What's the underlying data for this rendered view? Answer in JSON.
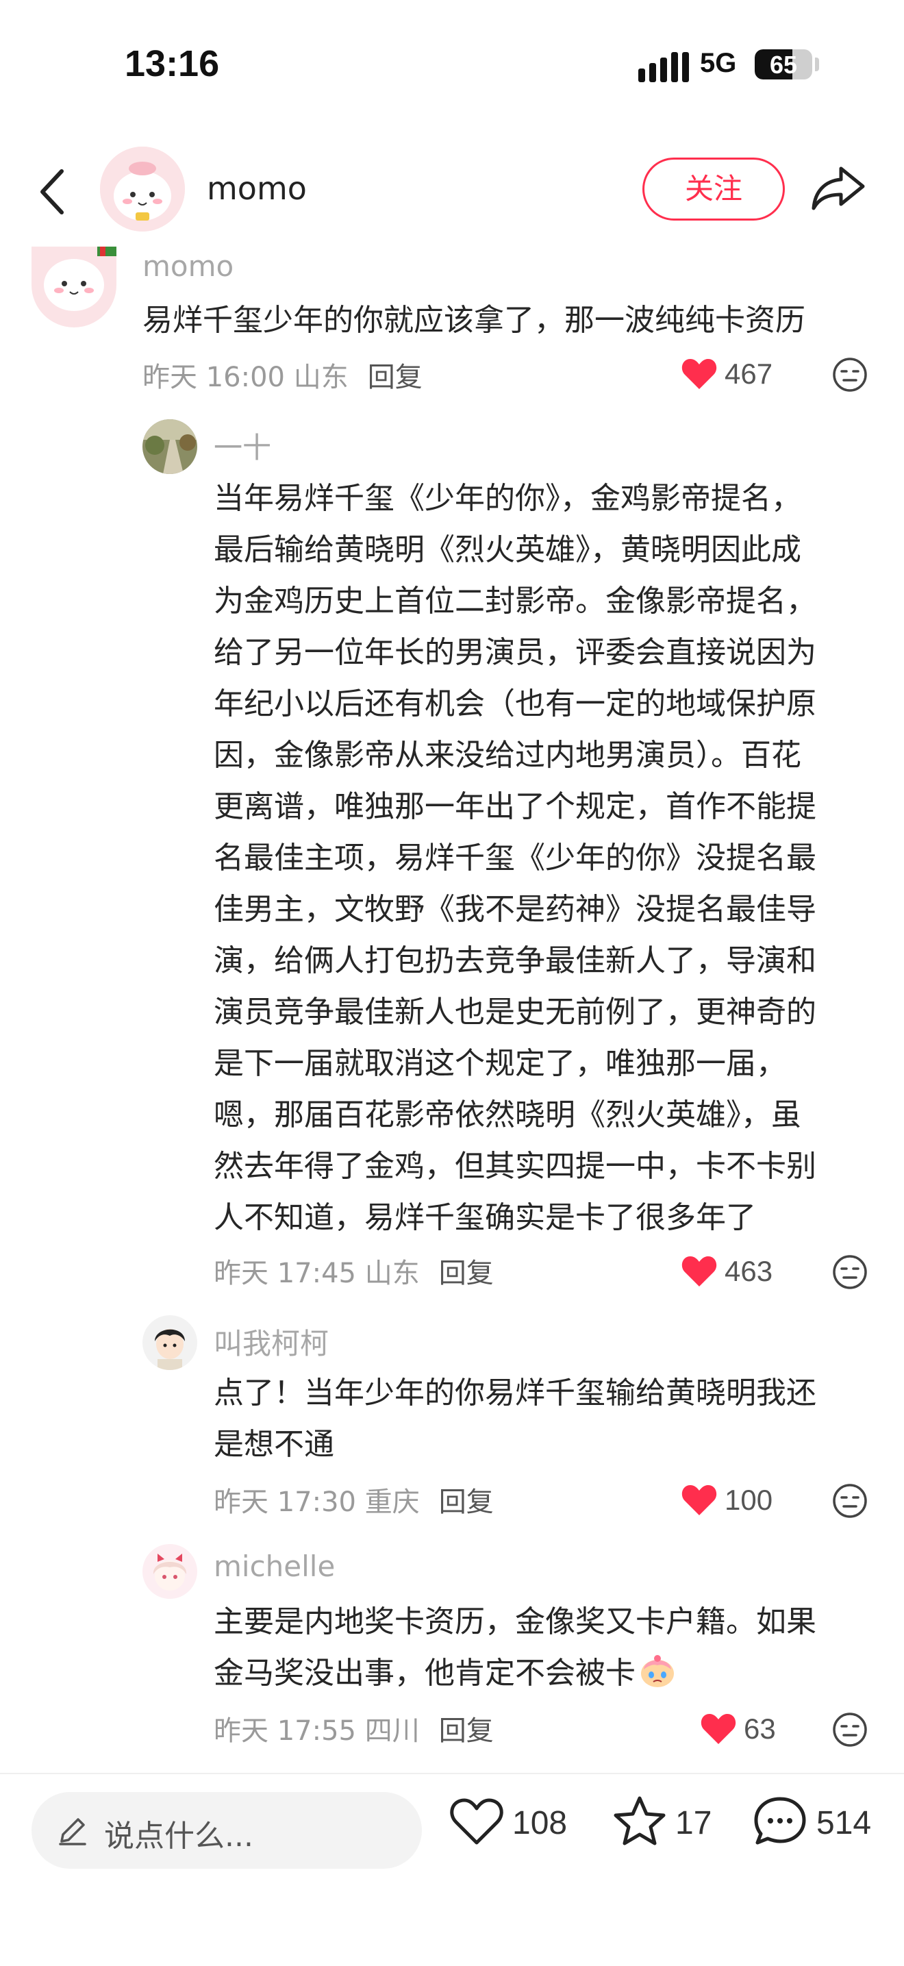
{
  "status_bar": {
    "time": "13:16",
    "network": "5G",
    "battery": "65",
    "battery_level": 0.65
  },
  "header": {
    "username": "momo",
    "follow_label": "关注"
  },
  "comments": [
    {
      "username": "momo",
      "text": "易烊千玺少年的你就应该拿了，那一波纯纯卡资历",
      "date": "昨天 16:00 山东",
      "reply_label": "回复",
      "likes": "467"
    },
    {
      "username": "一十",
      "lines": [
        "当年易烊千玺《少年的你》，金鸡影帝提名，",
        "最后输给黄晓明《烈火英雄》，黄晓明因此成",
        "为金鸡历史上首位二封影帝。金像影帝提名，",
        "给了另一位年长的男演员，评委会直接说因为",
        "年纪小以后还有机会（也有一定的地域保护原",
        "因，金像影帝从来没给过内地男演员）。百花",
        "更离谱，唯独那一年出了个规定，首作不能提",
        "名最佳主项，易烊千玺《少年的你》没提名最",
        "佳男主，文牧野《我不是药神》没提名最佳导",
        "演，给俩人打包扔去竞争最佳新人了，导演和",
        "演员竞争最佳新人也是史无前例了，更神奇的",
        "是下一届就取消这个规定了，唯独那一届，",
        "嗯，那届百花影帝依然晓明《烈火英雄》，虽",
        "然去年得了金鸡，但其实四提一中，卡不卡别",
        "人不知道，易烊千玺确实是卡了很多年了"
      ],
      "date": "昨天 17:45 山东",
      "reply_label": "回复",
      "likes": "463"
    },
    {
      "username": "叫我柯柯",
      "lines": [
        "点了！当年少年的你易烊千玺输给黄晓明我还",
        "是想不通"
      ],
      "date": "昨天 17:30 重庆",
      "reply_label": "回复",
      "likes": "100"
    },
    {
      "username": "michelle",
      "lines": [
        "主要是内地奖卡资历，金像奖又卡户籍。如果",
        "金马奖没出事，他肯定不会被卡"
      ],
      "date": "昨天 17:55 四川",
      "reply_label": "回复",
      "likes": "63"
    }
  ],
  "bottom_bar": {
    "placeholder": "说点什么...",
    "likes": "108",
    "stars": "17",
    "comments": "514"
  },
  "colors": {
    "accent": "#ff2e4d",
    "like_red": "#ff2e4d"
  }
}
